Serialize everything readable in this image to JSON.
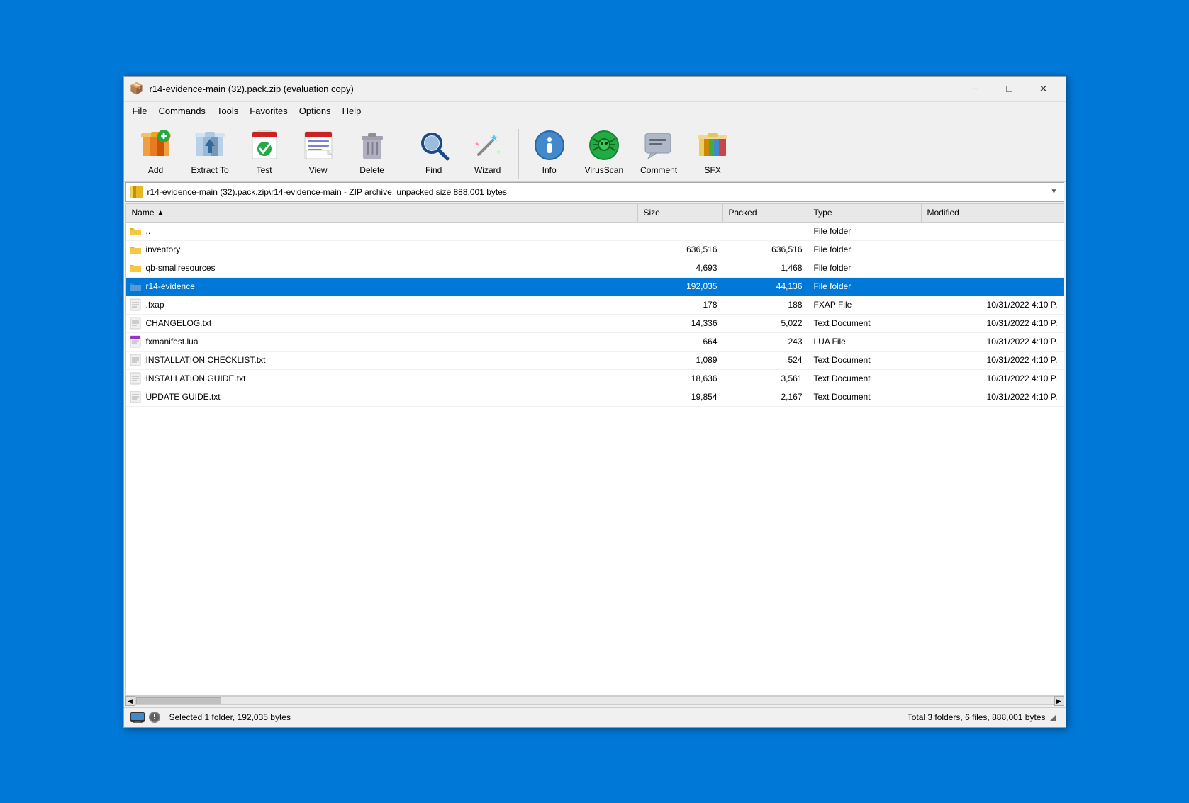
{
  "window": {
    "title": "r14-evidence-main (32).pack.zip (evaluation copy)",
    "icon": "📦"
  },
  "titlebar": {
    "minimize_label": "−",
    "maximize_label": "□",
    "close_label": "✕"
  },
  "menu": {
    "items": [
      "File",
      "Commands",
      "Tools",
      "Favorites",
      "Options",
      "Help"
    ]
  },
  "toolbar": {
    "buttons": [
      {
        "id": "add",
        "label": "Add"
      },
      {
        "id": "extract",
        "label": "Extract To"
      },
      {
        "id": "test",
        "label": "Test"
      },
      {
        "id": "view",
        "label": "View"
      },
      {
        "id": "delete",
        "label": "Delete"
      },
      {
        "id": "find",
        "label": "Find"
      },
      {
        "id": "wizard",
        "label": "Wizard"
      },
      {
        "id": "info",
        "label": "Info"
      },
      {
        "id": "virusscan",
        "label": "VirusScan"
      },
      {
        "id": "comment",
        "label": "Comment"
      },
      {
        "id": "sfx",
        "label": "SFX"
      }
    ]
  },
  "pathbar": {
    "path": "r14-evidence-main (32).pack.zip\\r14-evidence-main - ZIP archive, unpacked size 888,001 bytes"
  },
  "columns": {
    "name": "Name",
    "size": "Size",
    "packed": "Packed",
    "type": "Type",
    "modified": "Modified"
  },
  "files": [
    {
      "name": "..",
      "size": "",
      "packed": "",
      "type": "File folder",
      "modified": "",
      "icon": "folder",
      "color": "yellow",
      "selected": false
    },
    {
      "name": "inventory",
      "size": "636,516",
      "packed": "636,516",
      "type": "File folder",
      "modified": "",
      "icon": "folder",
      "color": "yellow",
      "selected": false
    },
    {
      "name": "qb-smallresources",
      "size": "4,693",
      "packed": "1,468",
      "type": "File folder",
      "modified": "",
      "icon": "folder",
      "color": "yellow",
      "selected": false
    },
    {
      "name": "r14-evidence",
      "size": "192,035",
      "packed": "44,136",
      "type": "File folder",
      "modified": "",
      "icon": "folder",
      "color": "blue",
      "selected": true
    },
    {
      "name": ".fxap",
      "size": "178",
      "packed": "188",
      "type": "FXAP File",
      "modified": "10/31/2022 4:10 P.",
      "icon": "file",
      "color": "gray",
      "selected": false
    },
    {
      "name": "CHANGELOG.txt",
      "size": "14,336",
      "packed": "5,022",
      "type": "Text Document",
      "modified": "10/31/2022 4:10 P.",
      "icon": "txt",
      "color": "gray",
      "selected": false
    },
    {
      "name": "fxmanifest.lua",
      "size": "664",
      "packed": "243",
      "type": "LUA File",
      "modified": "10/31/2022 4:10 P.",
      "icon": "lua",
      "color": "purple",
      "selected": false
    },
    {
      "name": "INSTALLATION CHECKLIST.txt",
      "size": "1,089",
      "packed": "524",
      "type": "Text Document",
      "modified": "10/31/2022 4:10 P.",
      "icon": "txt",
      "color": "gray",
      "selected": false
    },
    {
      "name": "INSTALLATION GUIDE.txt",
      "size": "18,636",
      "packed": "3,561",
      "type": "Text Document",
      "modified": "10/31/2022 4:10 P.",
      "icon": "txt",
      "color": "gray",
      "selected": false
    },
    {
      "name": "UPDATE GUIDE.txt",
      "size": "19,854",
      "packed": "2,167",
      "type": "Text Document",
      "modified": "10/31/2022 4:10 P.",
      "icon": "txt",
      "color": "gray",
      "selected": false
    }
  ],
  "statusbar": {
    "left": "Selected 1 folder, 192,035 bytes",
    "right": "Total 3 folders, 6 files, 888,001 bytes"
  }
}
